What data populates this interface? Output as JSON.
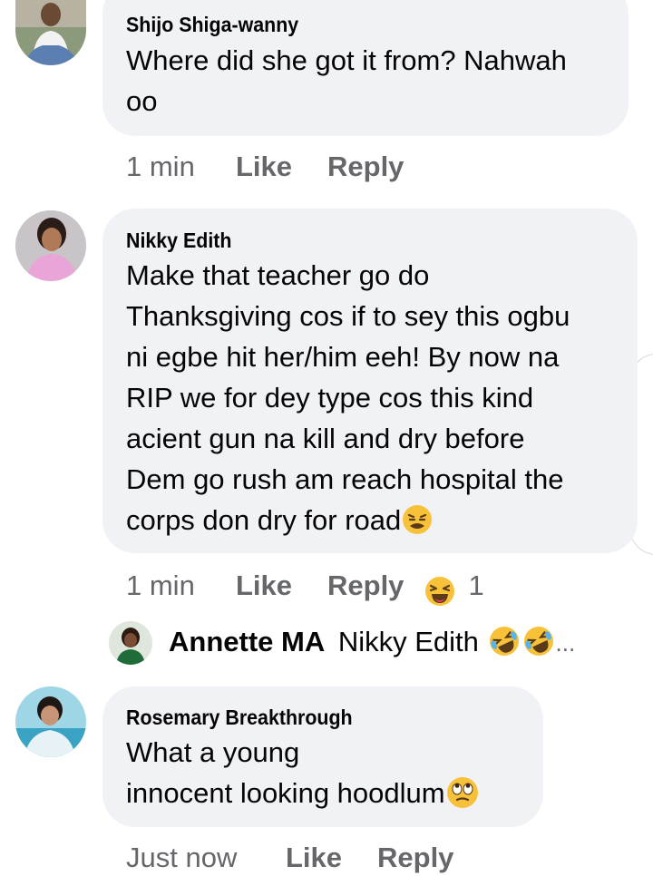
{
  "comments": [
    {
      "author": "Shijo Shiga-wanny",
      "lines": [
        "Where did she got it from? Nahwah",
        "oo"
      ],
      "time": "1 min",
      "like": "Like",
      "reply": "Reply"
    },
    {
      "author": "Nikky Edith",
      "lines": [
        "Make that teacher go do",
        "Thanksgiving cos if to sey this ogbu",
        "ni egbe hit her/him eeh! By now na",
        "RIP we for dey type cos this kind",
        "acient gun na kill and dry before",
        "Dem go rush am reach hospital the",
        "corps don dry for road"
      ],
      "time": "1 min",
      "like": "Like",
      "reply": "Reply",
      "reaction_count": "1",
      "reaction_icon": "laughing-reaction-icon",
      "reply_preview": {
        "author": "Annette MA",
        "text": "Nikky Edith",
        "more": "..."
      }
    },
    {
      "author": "Rosemary Breakthrough",
      "lines": [
        "What a young",
        "innocent looking hoodlum"
      ],
      "time": "Just now",
      "like": "Like",
      "reply": "Reply"
    }
  ],
  "colors": {
    "bubble": "#f0f2f5",
    "meta": "#65676b",
    "text": "#050505"
  }
}
